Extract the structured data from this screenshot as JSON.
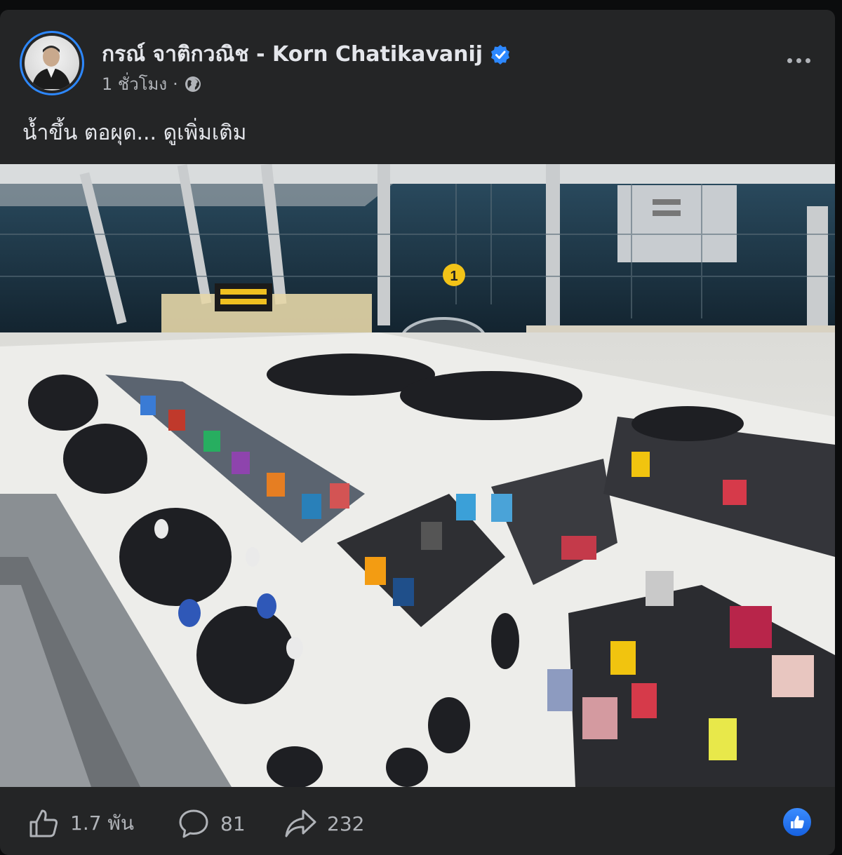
{
  "post": {
    "author": "กรณ์ จาติกวณิช - Korn Chatikavanij",
    "time": "1 ชั่วโมง",
    "separator": "·",
    "text": "น้ำขึ้น ตอผุด... ดูเพิ่มเติม"
  },
  "photo": {
    "gate_sign": "1"
  },
  "actions": {
    "likes": "1.7 พัน",
    "comments": "81",
    "shares": "232"
  },
  "icons": {
    "verified": "verified-badge-icon",
    "audience": "globe-icon",
    "more": "more-options-icon",
    "like": "thumbs-up-icon",
    "comment": "comment-bubble-icon",
    "share": "share-arrow-icon",
    "reaction": "like-reaction-icon"
  },
  "colors": {
    "card_bg": "#242526",
    "accent": "#2d88ff",
    "text_primary": "#e4e6eb",
    "text_secondary": "#b0b3b8"
  }
}
